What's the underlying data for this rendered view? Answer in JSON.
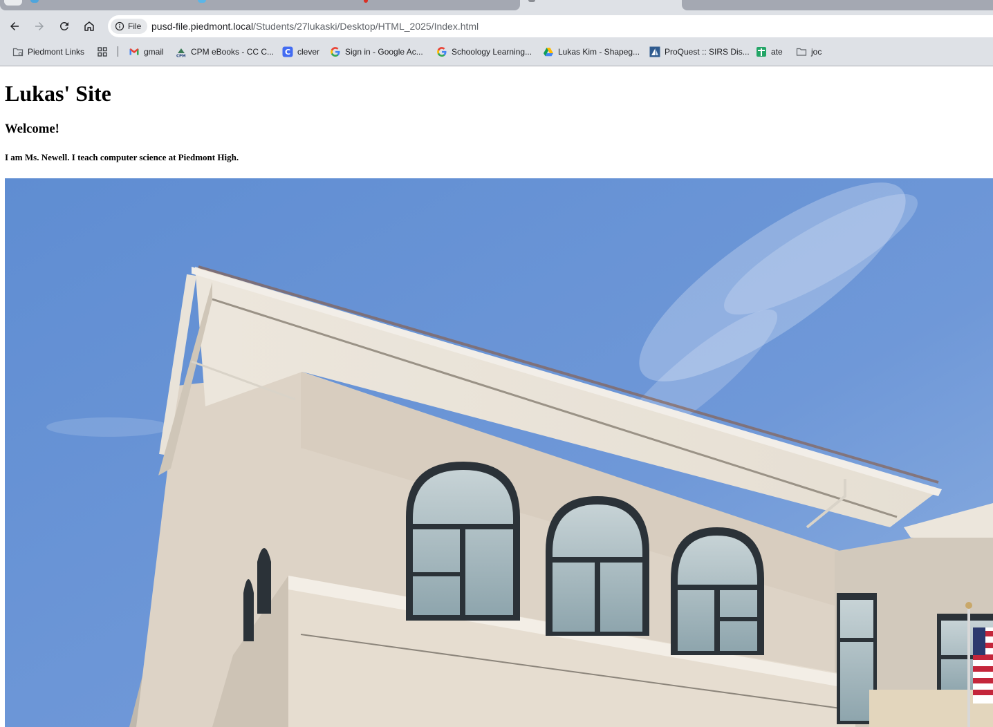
{
  "browser": {
    "address_bar": {
      "security_chip": "File",
      "url_host": "pusd-file.piedmont.local",
      "url_path": "/Students/27lukaski/Desktop/HTML_2025/Index.html"
    },
    "bookmarks": [
      {
        "label": "Piedmont Links",
        "icon": "managed-folder-icon"
      },
      {
        "label": "",
        "icon": "apps-grid-icon"
      },
      {
        "label": "gmail",
        "icon": "gmail-icon"
      },
      {
        "label": "CPM eBooks - CC C...",
        "icon": "cpm-icon"
      },
      {
        "label": "clever",
        "icon": "clever-icon"
      },
      {
        "label": "Sign in - Google Ac...",
        "icon": "google-icon"
      },
      {
        "label": "Schoology Learning...",
        "icon": "google-icon"
      },
      {
        "label": "Lukas Kim - Shapeg...",
        "icon": "google-drive-icon"
      },
      {
        "label": "ProQuest :: SIRS Dis...",
        "icon": "proquest-icon"
      },
      {
        "label": "ate",
        "icon": "google-sheets-icon"
      },
      {
        "label": "joc",
        "icon": "folder-icon"
      }
    ]
  },
  "page": {
    "heading": "Lukas' Site",
    "subheading": "Welcome!",
    "intro": "I am Ms. Newell. I teach computer science at Piedmont High."
  },
  "colors": {
    "browser_chrome": "#dee1e6",
    "sky": "#6b95d6",
    "building_wall": "#ddd3c6"
  }
}
